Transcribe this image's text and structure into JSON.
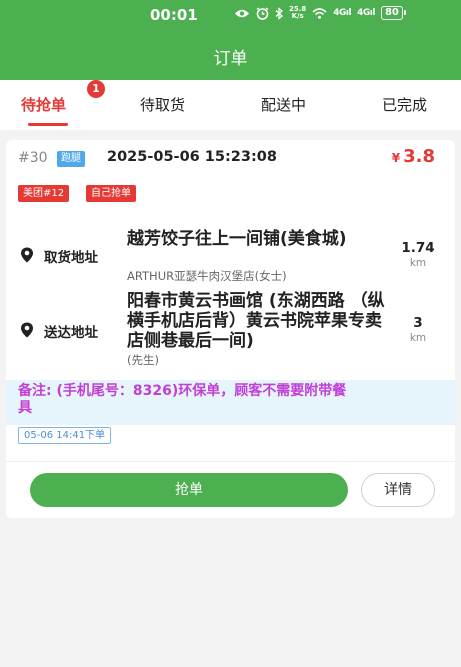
{
  "status_bar": {
    "time": "00:01",
    "net_speed_top": "25.8",
    "net_speed_bottom": "K/s",
    "signal_1": "4Gıl",
    "signal_2": "4Gıl",
    "battery": "80"
  },
  "header": {
    "title": "订单"
  },
  "tabs": [
    {
      "label": "待抢单",
      "active": true,
      "badge": "1"
    },
    {
      "label": "待取货"
    },
    {
      "label": "配送中"
    },
    {
      "label": "已完成"
    }
  ],
  "order": {
    "number": "#30",
    "type_tag": "跑腿",
    "time": "2025-05-06 15:23:08",
    "price_currency": "¥",
    "price": "3.8",
    "tags": [
      "美团#12",
      "自己抢单"
    ],
    "pickup": {
      "label": "取货地址",
      "name": "越芳饺子往上一间铺(美食城)",
      "sub": "ARTHUR亚瑟牛肉汉堡店(女士)",
      "distance": "1.74",
      "unit": "km"
    },
    "delivery": {
      "label": "送达地址",
      "name": "阳春市黄云书画馆 (东湖西路 （纵横手机店后背）黄云书院苹果专卖店侧巷最后一间)",
      "sub": "(先生)",
      "distance": "3",
      "unit": "km"
    },
    "note": "备注: (手机尾号：8326)环保单，顾客不需要附带餐具",
    "order_time_tag": "05-06 14:41下单"
  },
  "actions": {
    "grab": "抢单",
    "detail": "详情"
  },
  "colors": {
    "primary_green": "#4caf50",
    "accent_red": "#e53935",
    "note_purple": "#c23fd6",
    "tag_blue": "#4fa8e8"
  }
}
